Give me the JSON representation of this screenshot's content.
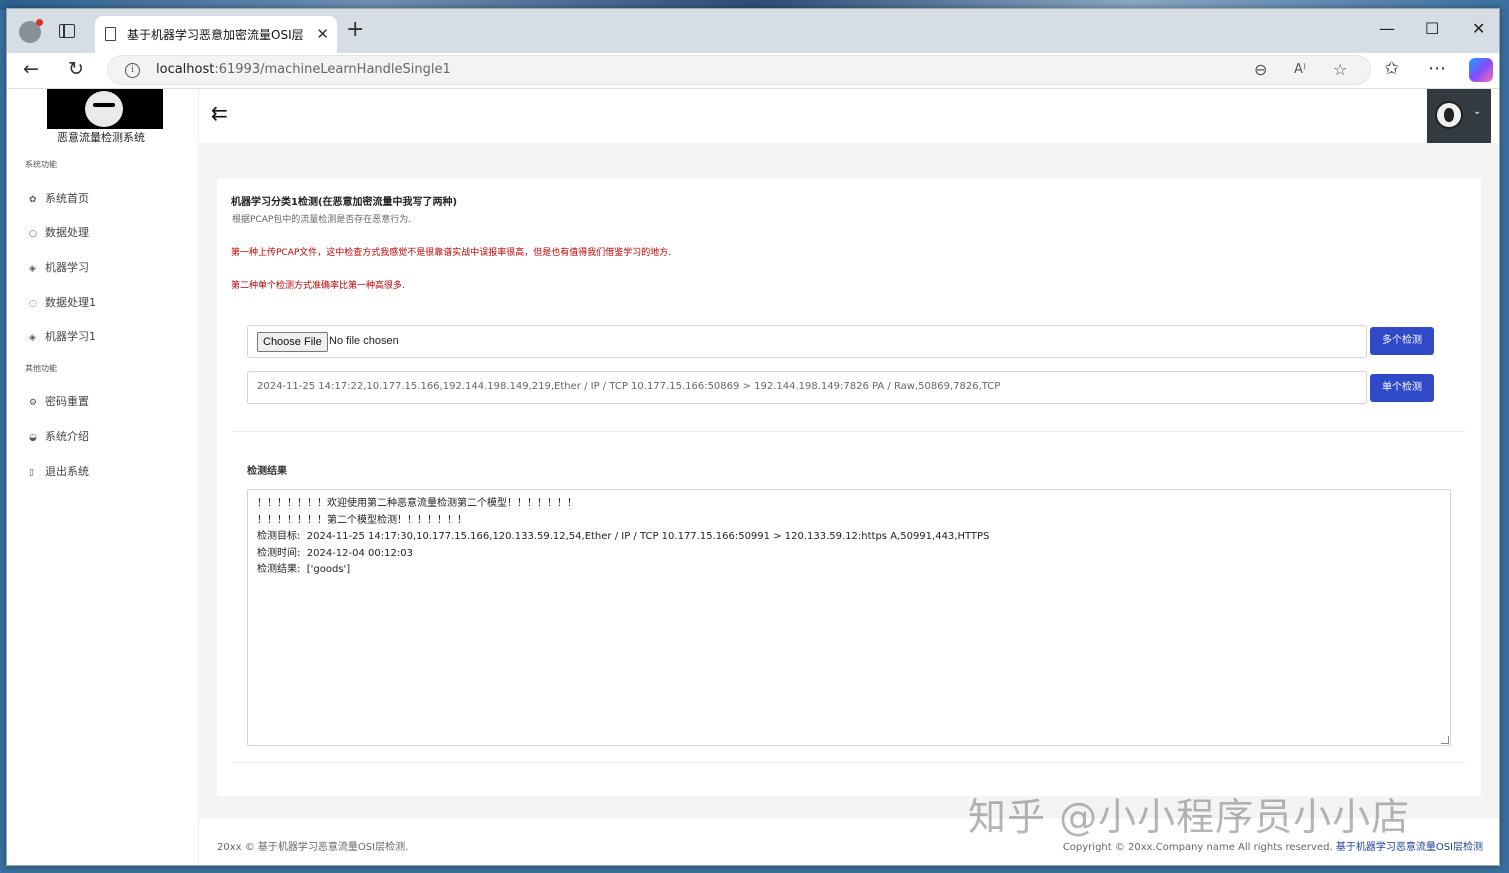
{
  "browser": {
    "tab_title": "基于机器学习恶意加密流量OSI层检测",
    "new_tab": "+",
    "url_host": "localhost",
    "url_path": ":61993/machineLearnHandleSingle1",
    "window_controls": [
      "—",
      "☐",
      "✕"
    ]
  },
  "sidebar": {
    "logo_text": "恶意流量检测系统",
    "group1": "系统功能",
    "items1": [
      {
        "icon": "home-icon",
        "label": "系统首页"
      },
      {
        "icon": "circle-icon",
        "label": "数据处理"
      },
      {
        "icon": "gem-icon",
        "label": "机器学习"
      },
      {
        "icon": "search-icon",
        "label": "数据处理1"
      },
      {
        "icon": "gem-icon",
        "label": "机器学习1"
      }
    ],
    "group2": "其他功能",
    "items2": [
      {
        "icon": "key-icon",
        "label": "密码重置"
      },
      {
        "icon": "info-icon",
        "label": "系统介绍"
      },
      {
        "icon": "logout-icon",
        "label": "退出系统"
      }
    ]
  },
  "header": {
    "menu_toggle": "⇇",
    "avatar_caret": "⌄"
  },
  "card": {
    "title": "机器学习分类1检测(在恶意加密流量中我写了两种)",
    "subtitle": "根据PCAP包中的流量检测是否存在恶意行为.",
    "note1": "第一种上传PCAP文件，这中检查方式我感觉不是很靠谱实战中误报率很高，但是也有值得我们借鉴学习的地方.",
    "note2": "第二种单个检测方式准确率比第一种高很多.",
    "file_button": "Choose File",
    "file_status": "No file chosen",
    "multi_button": "多个检测",
    "single_value": "2024-11-25 14:17:22,10.177.15.166,192.144.198.149,219,Ether / IP / TCP 10.177.15.166:50869 > 192.144.198.149:7826 PA / Raw,50869,7826,TCP",
    "single_button": "单个检测",
    "result_label": "检测结果",
    "result_lines": [
      "！！！！！！！欢迎使用第二种恶意流量检测第二个模型！！！！！！！",
      "！！！！！！！第二个模型检测！！！！！！！",
      "检测目标:  2024-11-25 14:17:30,10.177.15.166,120.133.59.12,54,Ether / IP / TCP 10.177.15.166:50991 > 120.133.59.12:https A,50991,443,HTTPS",
      "检测时间:  2024-12-04 00:12:03",
      "检测结果:  ['goods']"
    ]
  },
  "footer": {
    "left": "20xx © 基于机器学习恶意流量OSI层检测.",
    "right_text": "Copyright © 20xx.Company name All rights reserved.",
    "right_link": "基于机器学习恶意流量OSI层检测"
  },
  "watermark": "知乎 @小小程序员小小店"
}
